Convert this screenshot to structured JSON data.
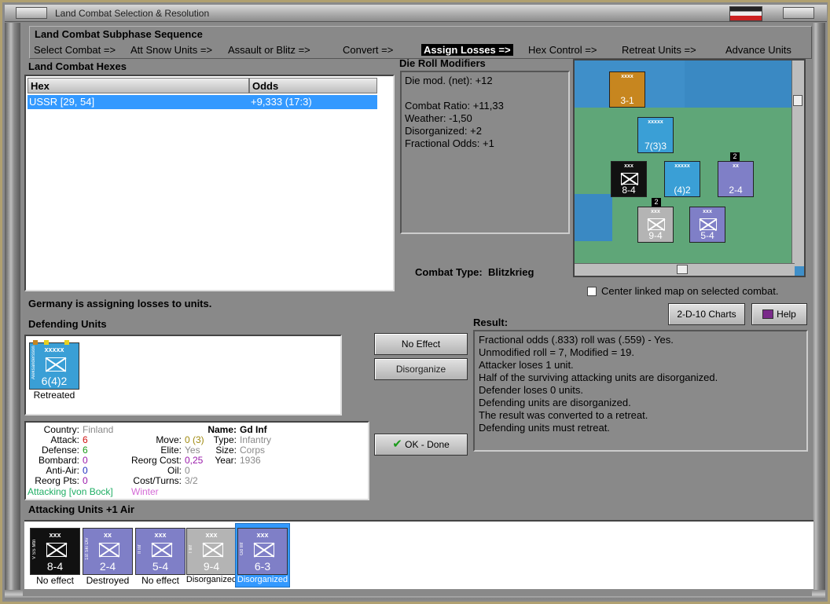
{
  "window": {
    "title": "Land Combat Selection & Resolution"
  },
  "colors": {
    "selection": "#3399ff",
    "finland_blue": "#3a9fd6",
    "german_black": "#111111",
    "german_purple": "#7f7fc7",
    "german_grey": "#b4b4b4",
    "brown": "#c7861f",
    "dim_text": "#8a8a8a",
    "red": "#d01010",
    "green": "#1a9a1a",
    "purple": "#9a1aaa",
    "blue": "#2030c0",
    "attacking_green": "#1fae64",
    "winter_pink": "#d46ad6"
  },
  "sequence": {
    "title": "Land Combat Subphase Sequence",
    "steps": [
      "Select Combat =>",
      "Att Snow Units =>",
      "Assault or Blitz =>",
      "Convert =>",
      "Assign Losses =>",
      "Hex Control =>",
      "Retreat Units =>",
      "Advance Units"
    ],
    "active_index": 4
  },
  "hexes": {
    "label": "Land Combat Hexes",
    "columns": [
      "Hex",
      "Odds"
    ],
    "rows": [
      {
        "hex": "USSR [29, 54]",
        "odds": "+9,333 (17:3)"
      }
    ]
  },
  "die_roll": {
    "label": "Die Roll Modifiers",
    "lines": [
      "Die mod. (net): +12",
      "",
      "Combat Ratio: +11,33",
      "Weather: -1,50",
      "Disorganized: +2",
      "Fractional Odds: +1"
    ]
  },
  "map": {
    "counters": [
      {
        "value": "3-1",
        "size": "xxxx",
        "color": "brown"
      },
      {
        "value": "7(3)3",
        "size": "xxxxx",
        "color": "finland_blue"
      },
      {
        "value": "8-4",
        "size": "xxx",
        "color": "german_black"
      },
      {
        "value": "(4)2",
        "size": "xxxxx",
        "color": "finland_blue"
      },
      {
        "value": "2-4",
        "size": "xx",
        "color": "german_purple"
      },
      {
        "value": "9-4",
        "size": "xxx",
        "color": "german_grey"
      },
      {
        "value": "5-4",
        "size": "xxx",
        "color": "german_purple"
      }
    ],
    "stack_badges": [
      "2",
      "2"
    ]
  },
  "combat_type": {
    "label": "Combat Type:",
    "value": "Blitzkrieg"
  },
  "center_checkbox": {
    "label": "Center linked map on selected combat.",
    "checked": false
  },
  "buttons": {
    "charts": "2-D-10 Charts",
    "help": "Help",
    "no_effect": "No Effect",
    "disorganize": "Disorganize",
    "ok_done": "OK - Done"
  },
  "message": "Germany is assigning losses to units.",
  "defending": {
    "label": "Defending Units",
    "units": [
      {
        "value": "6(4)2",
        "size": "xxxxx",
        "side": "Aleksandersson",
        "caption": "Retreated",
        "color": "finland_blue"
      }
    ]
  },
  "unit_info": {
    "country_label": "Country:",
    "country": "Finland",
    "attack_label": "Attack:",
    "attack": "6",
    "defense_label": "Defense:",
    "defense": "6",
    "bombard_label": "Bombard:",
    "bombard": "0",
    "antiair_label": "Anti-Air:",
    "antiair": "0",
    "reorg_label": "Reorg Pts:",
    "reorg": "0",
    "name_label": "Name:",
    "name": "Gd Inf",
    "move_label": "Move:",
    "move": "0 (3)",
    "type_label": "Type:",
    "type": "Infantry",
    "elite_label": "Elite:",
    "elite": "Yes",
    "size_label": "Size:",
    "size": "Corps",
    "reorgcost_label": "Reorg Cost:",
    "reorgcost": "0,25",
    "year_label": "Year:",
    "year": "1936",
    "oil_label": "Oil:",
    "oil": "0",
    "costturns_label": "Cost/Turns:",
    "costturns": "3/2",
    "attacking": "Attacking [von Bock]",
    "weather": "Winter"
  },
  "result": {
    "label": "Result:",
    "lines": [
      "Fractional odds (.833) roll was (.559)  - Yes.",
      "Unmodified roll = 7, Modified = 19.",
      "Attacker loses 1 unit.",
      "Half of the surviving attacking units are disorganized.",
      "Defender loses 0 units.",
      "Defending units are disorganized.",
      "The result was converted to a retreat.",
      "Defending units must retreat."
    ]
  },
  "attacking": {
    "label": "Attacking Units +1 Air",
    "units": [
      {
        "value": "8-4",
        "size": "xxx",
        "side": "V SS Mtn",
        "caption": "No effect",
        "color": "german_black"
      },
      {
        "value": "2-4",
        "size": "xx",
        "side": "1st Ski Div",
        "caption": "Destroyed",
        "color": "german_purple"
      },
      {
        "value": "5-4",
        "size": "xxx",
        "side": "II Inf",
        "caption": "No effect",
        "color": "german_purple"
      },
      {
        "value": "9-4",
        "size": "xxx",
        "side": "I Inf",
        "caption": "Disorganized",
        "color": "german_grey"
      },
      {
        "value": "6-3",
        "size": "xxx",
        "side": "Gd Inf",
        "caption": "Disorganized",
        "color": "german_purple",
        "selected": true
      }
    ]
  }
}
